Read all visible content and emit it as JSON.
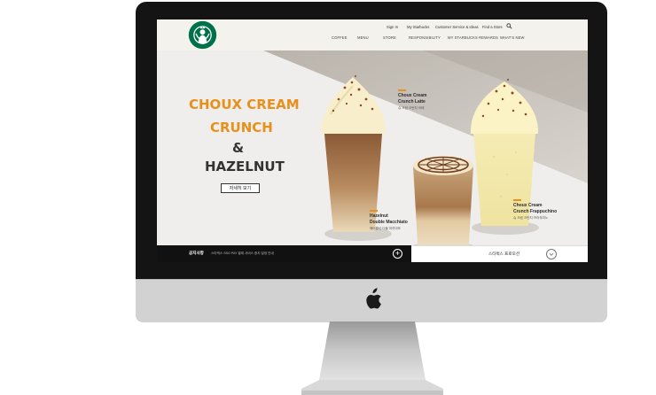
{
  "header": {
    "util_links": [
      "Sign In",
      "My Starbucks",
      "Customer Service & Ideas",
      "Find a Store"
    ],
    "gnb": [
      "COFFEE",
      "MENU",
      "STORE",
      "RESPONSIBILITY",
      "MY STARBUCKS REWARDS",
      "WHAT'S NEW"
    ]
  },
  "hero": {
    "line1": "CHOUX CREAM",
    "line2": "CRUNCH",
    "line3": "&",
    "line4": "HAZELNUT",
    "button": "자세히 보기",
    "products": [
      {
        "name1": "Choux Cream",
        "name2": "Crunch Latte",
        "kr": "슈 크림 크런치 라떼"
      },
      {
        "name1": "Hazelnut",
        "name2": "Double Macchiato",
        "kr": "헤이즐넛 더블 마끼아또"
      },
      {
        "name1": "Choux Cream",
        "name2": "Crunch Frappuchino",
        "kr": "슈 크림 크런치 프라푸치노"
      }
    ]
  },
  "notice": {
    "title": "공지사항",
    "text": "스타벅스 SSG PAY 결제 서비스 중지 일정 안내"
  },
  "promo": {
    "label": "스타벅스 프로모션"
  },
  "colors": {
    "accent": "#e8901c",
    "brand_green": "#00704a",
    "dark": "#333333"
  }
}
